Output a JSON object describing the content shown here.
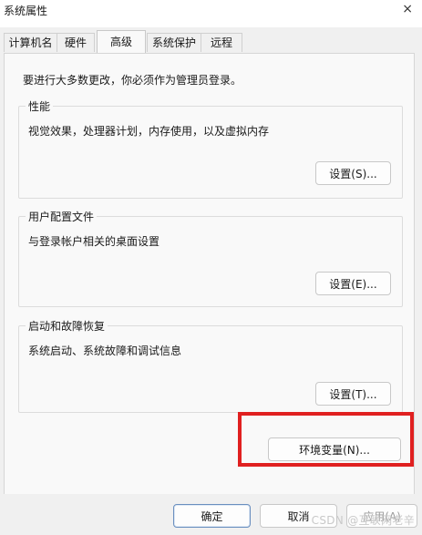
{
  "window": {
    "title": "系统属性",
    "close_glyph": "×"
  },
  "tabs": [
    "计算机名",
    "硬件",
    "高级",
    "系统保护",
    "远程"
  ],
  "active_tab": "高级",
  "note": "要进行大多数更改，你必须作为管理员登录。",
  "performance": {
    "title": "性能",
    "desc": "视觉效果，处理器计划，内存使用，以及虚拟内存",
    "button": "设置(S)..."
  },
  "user_profiles": {
    "title": "用户配置文件",
    "desc": "与登录帐户相关的桌面设置",
    "button": "设置(E)..."
  },
  "startup_recovery": {
    "title": "启动和故障恢复",
    "desc": "系统启动、系统故障和调试信息",
    "button": "设置(T)..."
  },
  "env_button": "环境变量(N)...",
  "footer": {
    "ok": "确定",
    "cancel": "取消",
    "apply": "应用(A)"
  },
  "watermark": "CSDN @互联网老辛",
  "colors": {
    "highlight": "#e02020",
    "primary_border": "#6a8fbf"
  }
}
